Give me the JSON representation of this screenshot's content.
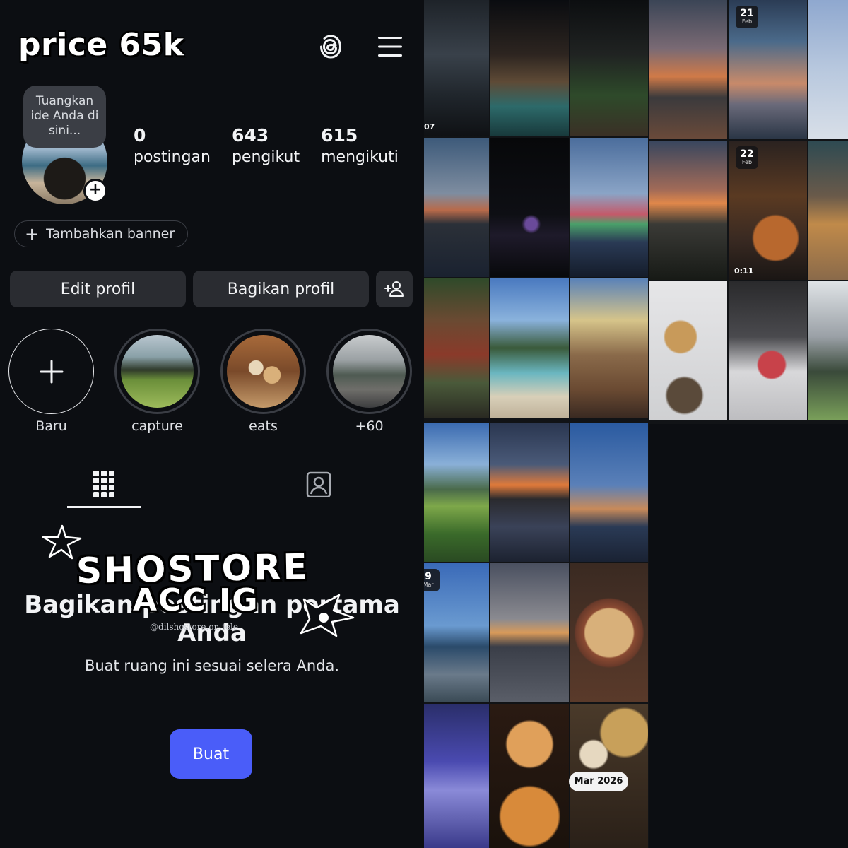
{
  "overlay": {
    "price_text": "price 65k",
    "watermark_line1": "SHOSTORE",
    "watermark_line2": "ACC IG",
    "watermark_handle": "@dilshostore.on.tele"
  },
  "header": {
    "threads_icon": "threads-icon",
    "menu_icon": "hamburger-menu-icon"
  },
  "profile": {
    "note_text": "Tuangkan ide Anda di sini...",
    "stats": [
      {
        "value": "0",
        "label": "postingan"
      },
      {
        "value": "643",
        "label": "pengikut"
      },
      {
        "value": "615",
        "label": "mengikuti"
      }
    ],
    "add_banner_label": "Tambahkan banner",
    "edit_label": "Edit profil",
    "share_label": "Bagikan profil"
  },
  "highlights": [
    {
      "label": "Baru"
    },
    {
      "label": "capture"
    },
    {
      "label": "eats"
    },
    {
      "label": "+60"
    }
  ],
  "empty_state": {
    "title": "Bagikan postingan pertama Anda",
    "subtitle": "Buat ruang ini sesuai selera Anda.",
    "button_label": "Buat"
  },
  "grid_badges": [
    {
      "day": "21",
      "month": "Feb"
    },
    {
      "day": "22",
      "month": "Feb"
    },
    {
      "day": "9",
      "month": "Mar"
    }
  ],
  "grid_video_time": "0:11",
  "grid_partial_label": "07",
  "grid_date_pill": "Mar 2026",
  "colors": {
    "background": "#0c0e12",
    "button": "#2a2c31",
    "primary": "#4a5df9"
  }
}
